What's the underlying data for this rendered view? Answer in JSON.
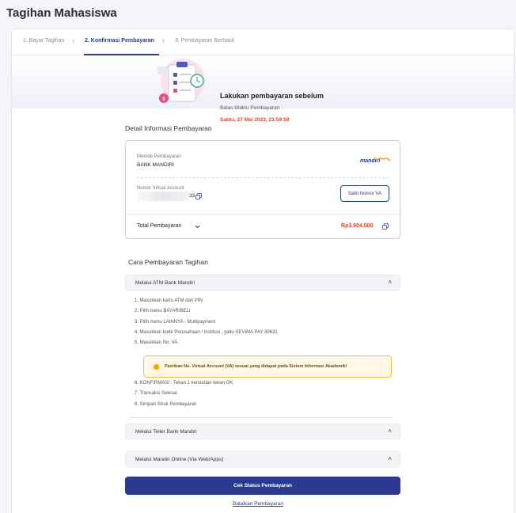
{
  "page": {
    "title": "Tagihan Mahasiswa"
  },
  "stepper": {
    "steps": [
      {
        "label": "1. Bayar Tagihan"
      },
      {
        "label": "2. Konfirmasi Pembayaran"
      },
      {
        "label": "3. Pembayaran Berhasil"
      }
    ],
    "active_index": 1
  },
  "banner": {
    "title": "Lakukan pembayaran sebelum",
    "deadline_label": "Batas Waktu Pembayaran :",
    "deadline_value": "Sabtu, 27 Mei 2023, 23:59:59"
  },
  "detail": {
    "section_title": "Detail Informasi Pembayaran",
    "method_label": "Metode Pembayaran",
    "method_value": "BANK MANDIRI",
    "bank_logo_text": "mandiri",
    "va_label": "Nomor Virtual Account",
    "va_visible_suffix": "33",
    "copy_va_button": "Salin Nomor VA",
    "total_label": "Total Pembayaran",
    "total_value": "Rp3.904.000"
  },
  "howto": {
    "section_title": "Cara Pembayaran Tagihan",
    "accordions": [
      {
        "label": "Melalui ATM Bank Mandiri"
      },
      {
        "label": "Melalui Teller Bank Mandiri"
      },
      {
        "label": "Melalui Mandiri Online (Via Web/Apps)"
      }
    ],
    "atm_steps_a": [
      "1.  Masukkan kartu ATM dan PIN",
      "2.  Pilih menu BAYAR/BELI",
      "3.  Pilih menu LAINNYA - Multipayment",
      "4.  Masukkan kode Perusahaan / Institusi , yaitu SEVIMA PAY 89631",
      "5.  Masukkan No. VA."
    ],
    "notice": "Pastikan No. Virtual Account (VA) sesuai yang didapat pada Sistem Informasi Akademik!",
    "atm_steps_b": [
      "6.  KONFIRMASI : Tekan 1 kemudian tekan OK",
      "7.  Transaksi Selesai",
      "8.  Simpan Struk Pembayaran"
    ]
  },
  "actions": {
    "check_status": "Cek Status Pembayaran",
    "cancel": "Batalkan Pembayaran"
  },
  "colors": {
    "primary": "#2b3a8f",
    "danger": "#e0402e",
    "warning": "#f2a500"
  }
}
